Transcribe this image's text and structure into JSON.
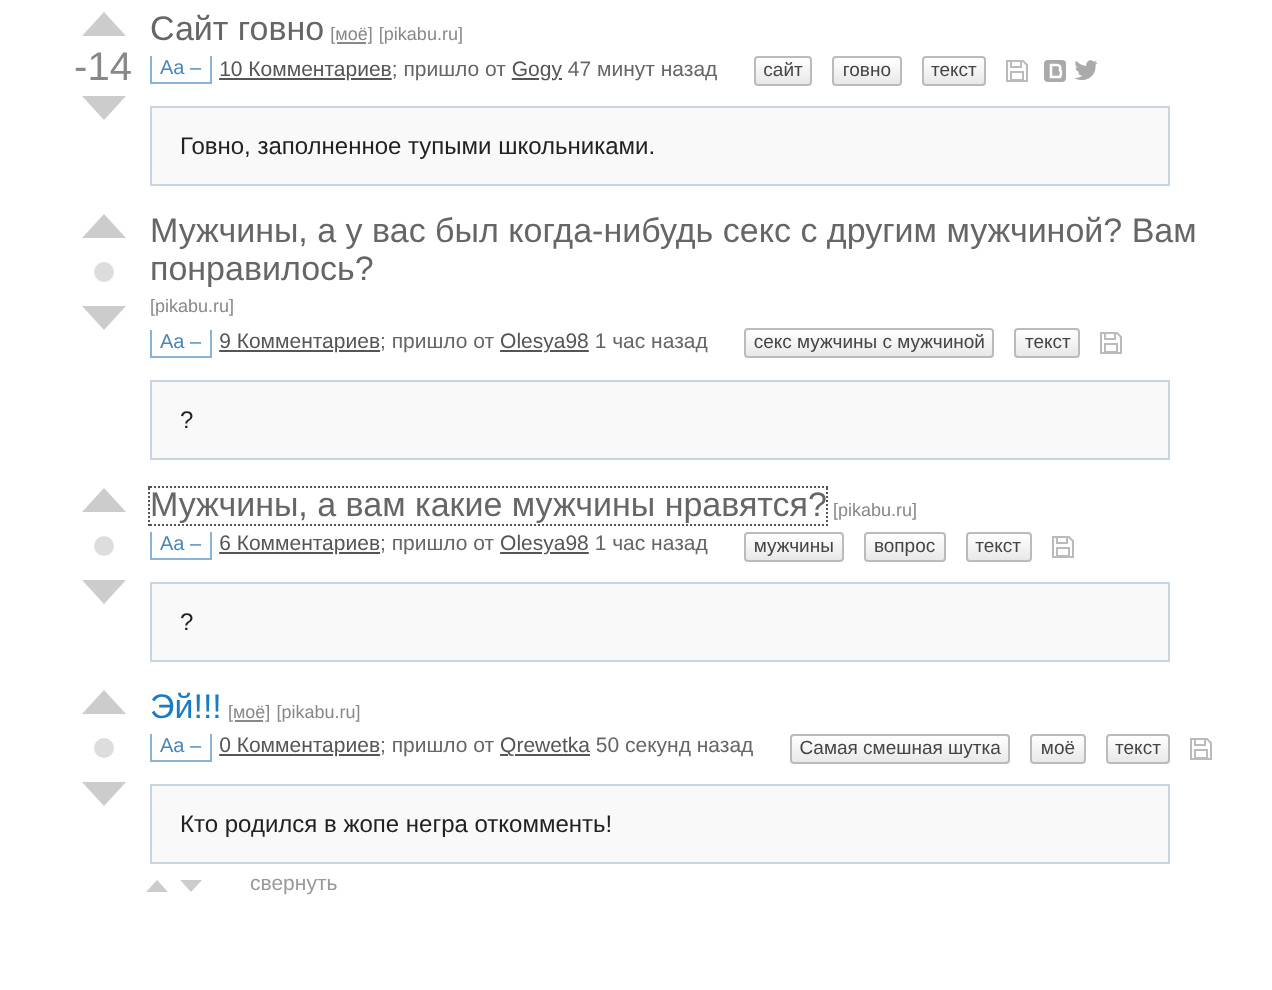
{
  "posts": [
    {
      "rating": "-14",
      "title": "Сайт говно",
      "title_highlight": false,
      "focused": false,
      "mine_label": "[моё]",
      "source": "[pikabu.ru]",
      "font_toggle": "Aa –",
      "comments": "10 Комментариев",
      "came_from": "; пришло от",
      "author": "Gogy",
      "time": "47 минут назад",
      "tags": [
        "сайт",
        "говно",
        "текст"
      ],
      "share": true,
      "body": "Говно, заполненное тупыми школьниками."
    },
    {
      "title": "Мужчины, а у вас был когда-нибудь секс с другим мужчиной? Вам понравилось?",
      "title_highlight": false,
      "focused": false,
      "source": "[pikabu.ru]",
      "font_toggle": "Aa –",
      "comments": "9 Комментариев",
      "came_from": "; пришло от",
      "author": "Olesya98",
      "time": "1 час назад",
      "tags": [
        "секс мужчины с мужчиной",
        "текст"
      ],
      "share": false,
      "body": "?"
    },
    {
      "title": "Мужчины, а вам какие мужчины нравятся?",
      "title_highlight": false,
      "focused": true,
      "source": "[pikabu.ru]",
      "font_toggle": "Aa –",
      "comments": "6 Комментариев",
      "came_from": "; пришло от",
      "author": "Olesya98",
      "time": "1 час назад",
      "tags": [
        "мужчины",
        "вопрос",
        "текст"
      ],
      "share": false,
      "body": "?"
    },
    {
      "title": "Эй!!!",
      "title_highlight": true,
      "focused": false,
      "mine_label": "[моё]",
      "source": "[pikabu.ru]",
      "font_toggle": "Aa –",
      "comments": "0 Комментариев",
      "came_from": "; пришло от",
      "author": "Qrewetka",
      "time": "50 секунд назад",
      "tags": [
        "Самая смешная шутка",
        "моё",
        "текст"
      ],
      "share": false,
      "body": "Кто родился в жопе негра откомменть!",
      "collapse": "свернуть"
    }
  ]
}
